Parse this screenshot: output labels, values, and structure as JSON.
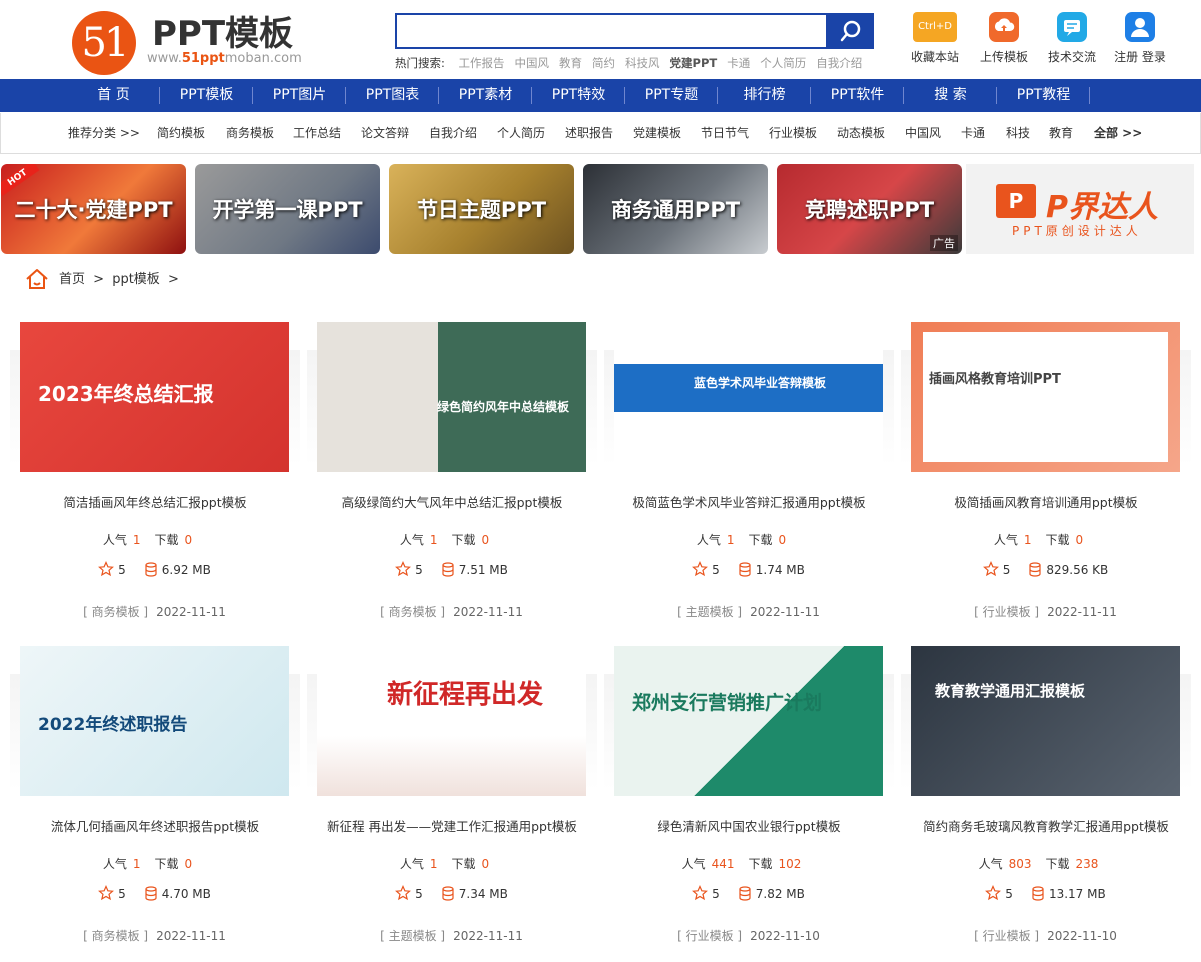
{
  "site": {
    "logo_mark": "51",
    "logo_title": "PPT模板",
    "logo_sub_prefix": "www.",
    "logo_sub_highlight": "51ppt",
    "logo_sub_suffix": "moban.com"
  },
  "search": {
    "value": "",
    "placeholder": "",
    "hot_label": "热门搜索:",
    "hot_words": [
      "工作报告",
      "中国风",
      "教育",
      "简约",
      "科技风",
      "党建PPT",
      "卡通",
      "个人简历",
      "自我介绍"
    ]
  },
  "quick_links": [
    {
      "label": "收藏本站",
      "icon": "bookmark-icon",
      "icon_text": "Ctrl+D",
      "color": "#f5a623"
    },
    {
      "label": "上传模板",
      "icon": "upload-icon",
      "color": "#f0692b"
    },
    {
      "label": "技术交流",
      "icon": "chat-icon",
      "color": "#22a9e6"
    },
    {
      "label": "注册 登录",
      "icon": "user-icon",
      "color": "#1e7fe6"
    }
  ],
  "main_nav": [
    "首 页",
    "PPT模板",
    "PPT图片",
    "PPT图表",
    "PPT素材",
    "PPT特效",
    "PPT专题",
    "排行榜",
    "PPT软件",
    "搜 索",
    "PPT教程"
  ],
  "sub_nav": [
    "推荐分类 >>",
    "简约模板",
    "商务模板",
    "工作总结",
    "论文答辩",
    "自我介绍",
    "个人简历",
    "述职报告",
    "党建模板",
    "节日节气",
    "行业模板",
    "动态模板",
    "中国风",
    "卡通",
    "科技",
    "教育",
    "全部 >>"
  ],
  "banners": [
    {
      "label": "二十大·党建PPT",
      "badge": "HOT"
    },
    {
      "label": "开学第一课PPT"
    },
    {
      "label": "节日主题PPT"
    },
    {
      "label": "商务通用PPT"
    },
    {
      "label": "竞聘述职PPT",
      "ad": "广告"
    }
  ],
  "ad_banner": {
    "logo_text": "P",
    "title": "P界达人",
    "subtitle": "PPT原创设计达人"
  },
  "breadcrumb": {
    "home": "首页",
    "sep1": ">",
    "current": "ppt模板",
    "sep2": ">"
  },
  "labels": {
    "popularity": "人气",
    "downloads": "下载"
  },
  "colors": {
    "brand_blue": "#1a44a8",
    "accent_orange": "#e9541d"
  },
  "cards": [
    {
      "title": "简洁插画风年终总结汇报ppt模板",
      "popularity": "1",
      "downloads": "0",
      "rating": "5",
      "size": "6.92 MB",
      "category": "[ 商务模板 ]",
      "date": "2022-11-11",
      "thumb_text": "2023年终总结汇报"
    },
    {
      "title": "高级绿简约大气风年中总结汇报ppt模板",
      "popularity": "1",
      "downloads": "0",
      "rating": "5",
      "size": "7.51 MB",
      "category": "[ 商务模板 ]",
      "date": "2022-11-11",
      "thumb_text": "绿色简约风年中总结模板"
    },
    {
      "title": "极简蓝色学术风毕业答辩汇报通用ppt模板",
      "popularity": "1",
      "downloads": "0",
      "rating": "5",
      "size": "1.74 MB",
      "category": "[ 主题模板 ]",
      "date": "2022-11-11",
      "thumb_text": "蓝色学术风毕业答辩模板"
    },
    {
      "title": "极简插画风教育培训通用ppt模板",
      "popularity": "1",
      "downloads": "0",
      "rating": "5",
      "size": "829.56 KB",
      "category": "[ 行业模板 ]",
      "date": "2022-11-11",
      "thumb_text": "插画风格教育培训PPT"
    },
    {
      "title": "流体几何插画风年终述职报告ppt模板",
      "popularity": "1",
      "downloads": "0",
      "rating": "5",
      "size": "4.70 MB",
      "category": "[ 商务模板 ]",
      "date": "2022-11-11",
      "thumb_text": "2022年终述职报告"
    },
    {
      "title": "新征程 再出发——党建工作汇报通用ppt模板",
      "popularity": "1",
      "downloads": "0",
      "rating": "5",
      "size": "7.34 MB",
      "category": "[ 主题模板 ]",
      "date": "2022-11-11",
      "thumb_text": "新征程再出发"
    },
    {
      "title": "绿色清新风中国农业银行ppt模板",
      "popularity": "441",
      "downloads": "102",
      "rating": "5",
      "size": "7.82 MB",
      "category": "[ 行业模板 ]",
      "date": "2022-11-10",
      "thumb_text": "郑州支行营销推广计划"
    },
    {
      "title": "简约商务毛玻璃风教育教学汇报通用ppt模板",
      "popularity": "803",
      "downloads": "238",
      "rating": "5",
      "size": "13.17 MB",
      "category": "[ 行业模板 ]",
      "date": "2022-11-10",
      "thumb_text": "教育教学通用汇报模板"
    }
  ]
}
